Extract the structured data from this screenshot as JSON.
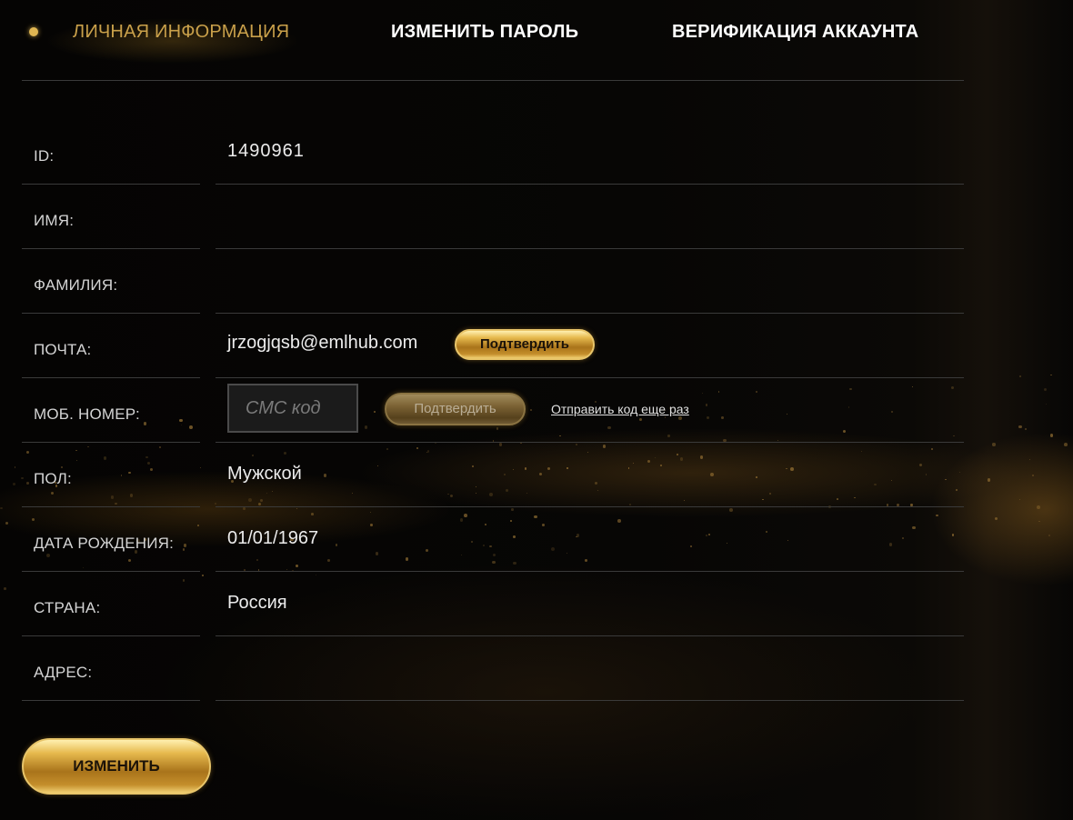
{
  "tabs": [
    {
      "label": "ЛИЧНАЯ ИНФОРМАЦИЯ",
      "active": true
    },
    {
      "label": "ИЗМЕНИТЬ ПАРОЛЬ",
      "active": false
    },
    {
      "label": "ВЕРИФИКАЦИЯ АККАУНТА",
      "active": false
    }
  ],
  "fields": {
    "id": {
      "label": "ID:",
      "value": "1490961"
    },
    "first_name": {
      "label": "ИМЯ:",
      "value": ""
    },
    "last_name": {
      "label": "ФАМИЛИЯ:",
      "value": ""
    },
    "email": {
      "label": "ПОЧТА:",
      "value": "jrzogjqsb@emlhub.com",
      "confirm_label": "Подтвердить"
    },
    "phone": {
      "label": "МОБ. НОМЕР:",
      "sms_placeholder": "СМС код",
      "confirm_label": "Подтвердить",
      "resend_label": "Отправить код еще раз"
    },
    "gender": {
      "label": "ПОЛ:",
      "value": "Мужской"
    },
    "birth_date": {
      "label": "ДАТА РОЖДЕНИЯ:",
      "value": "01/01/1967"
    },
    "country": {
      "label": "СТРАНА:",
      "value": "Россия"
    },
    "address": {
      "label": "АДРЕС:",
      "value": ""
    }
  },
  "actions": {
    "edit_label": "ИЗМЕНИТЬ"
  },
  "colors": {
    "accent_gold": "#c9a04a",
    "background": "#000000",
    "divider": "#3a3a3a"
  }
}
